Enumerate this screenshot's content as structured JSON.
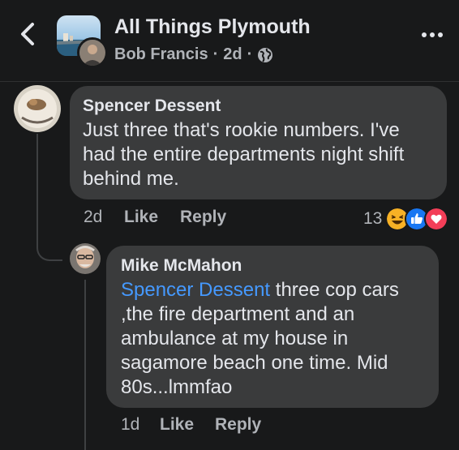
{
  "header": {
    "group_name": "All Things Plymouth",
    "poster_name": "Bob Francis",
    "separator": "·",
    "time": "2d",
    "separator2": "·",
    "privacy_icon": "globe-icon",
    "back_icon": "chevron-left-icon",
    "more_icon": "more-dots-icon"
  },
  "comments": [
    {
      "author": "Spencer Dessent",
      "text": "Just three that's rookie numbers. I've had the entire departments night shift behind me.",
      "time": "2d",
      "like_label": "Like",
      "reply_label": "Reply",
      "reaction_count": "13",
      "reactions": [
        "laugh-reaction-icon",
        "like-reaction-icon",
        "love-reaction-icon"
      ]
    },
    {
      "author": "Mike McMahon",
      "mention": "Spencer Dessent",
      "text": " three cop cars ,the fire department and an ambulance at my house in sagamore beach one time. Mid 80s...lmmfao",
      "time": "1d",
      "like_label": "Like",
      "reply_label": "Reply"
    }
  ],
  "colors": {
    "background": "#18191a",
    "bubble": "#3a3b3c",
    "text_primary": "#e4e6eb",
    "text_secondary": "#b0b3b8",
    "mention": "#4599ff",
    "like_blue": "#1877f2",
    "love_red": "#f33e58",
    "haha_yellow": "#f7b125"
  }
}
